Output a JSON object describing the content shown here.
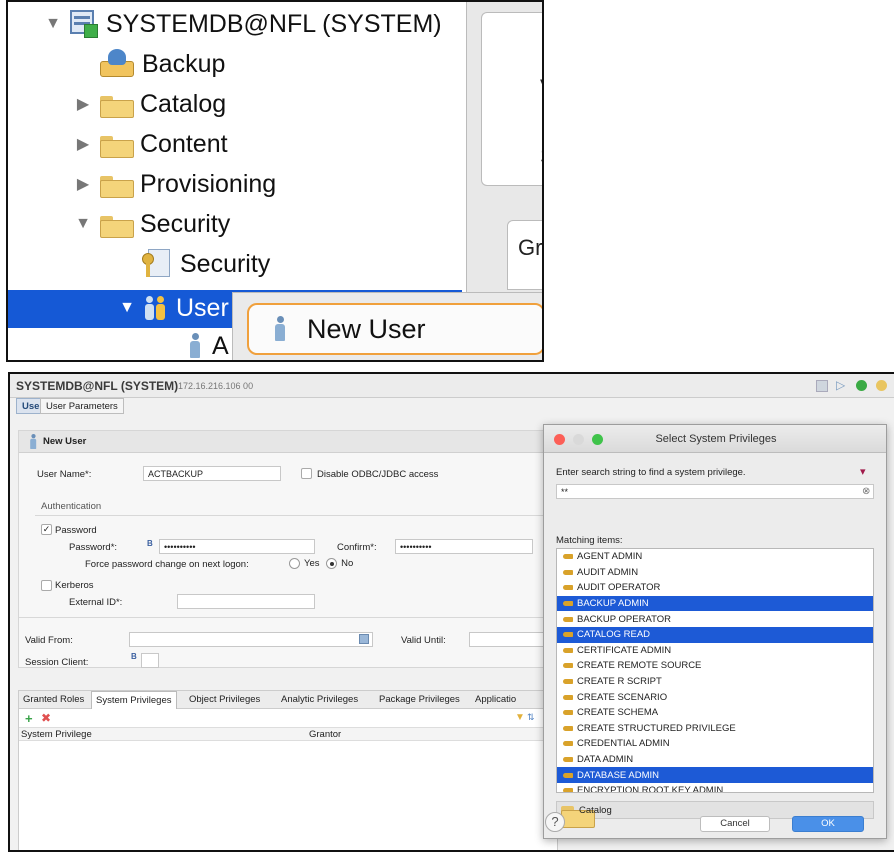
{
  "tree": {
    "root": "SYSTEMDB@NFL (SYSTEM)",
    "items": [
      {
        "label": "Backup"
      },
      {
        "label": "Catalog"
      },
      {
        "label": "Content"
      },
      {
        "label": "Provisioning"
      },
      {
        "label": "Security"
      },
      {
        "label": "Security"
      },
      {
        "label": "User"
      },
      {
        "label": "A"
      }
    ],
    "context_menu_item": "New User",
    "right_panel_fragments": [
      "V",
      "S",
      "Gr"
    ]
  },
  "window": {
    "title": "SYSTEMDB@NFL (SYSTEM)",
    "host": "172.16.216.106 00",
    "tabs": [
      "User",
      "User Parameters"
    ],
    "section_title": "New User",
    "user_name_label": "User Name*:",
    "user_name_value": "ACTBACKUP",
    "disable_odbc_label": "Disable ODBC/JDBC access",
    "authentication_label": "Authentication",
    "password_check_label": "Password",
    "password_label": "Password*:",
    "password_value": "••••••••••",
    "confirm_label": "Confirm*:",
    "confirm_value": "••••••••••",
    "force_label": "Force password change on next logon:",
    "yes_label": "Yes",
    "no_label": "No",
    "kerberos_label": "Kerberos",
    "external_id_label": "External ID*:",
    "valid_from_label": "Valid From:",
    "valid_until_label": "Valid Until:",
    "session_client_label": "Session Client:",
    "bottom_tabs": [
      "Granted Roles",
      "System Privileges",
      "Object Privileges",
      "Analytic Privileges",
      "Package Privileges",
      "Applicatio"
    ],
    "table_headers": [
      "System Privilege",
      "Grantor"
    ]
  },
  "dialog": {
    "title": "Select System Privileges",
    "prompt": "Enter search string to find a system privilege.",
    "search_value": "**",
    "matching_label": "Matching items:",
    "items": [
      {
        "label": "AGENT ADMIN",
        "selected": false
      },
      {
        "label": "AUDIT ADMIN",
        "selected": false
      },
      {
        "label": "AUDIT OPERATOR",
        "selected": false
      },
      {
        "label": "BACKUP ADMIN",
        "selected": true
      },
      {
        "label": "BACKUP OPERATOR",
        "selected": false
      },
      {
        "label": "CATALOG READ",
        "selected": true
      },
      {
        "label": "CERTIFICATE ADMIN",
        "selected": false
      },
      {
        "label": "CREATE REMOTE SOURCE",
        "selected": false
      },
      {
        "label": "CREATE R SCRIPT",
        "selected": false
      },
      {
        "label": "CREATE SCENARIO",
        "selected": false
      },
      {
        "label": "CREATE SCHEMA",
        "selected": false
      },
      {
        "label": "CREATE STRUCTURED PRIVILEGE",
        "selected": false
      },
      {
        "label": "CREDENTIAL ADMIN",
        "selected": false
      },
      {
        "label": "DATA ADMIN",
        "selected": false
      },
      {
        "label": "DATABASE ADMIN",
        "selected": true
      },
      {
        "label": "ENCRYPTION ROOT KEY ADMIN",
        "selected": false
      }
    ],
    "footer_item": "Catalog",
    "cancel_label": "Cancel",
    "ok_label": "OK",
    "colors": {
      "selection": "#1d5ad6",
      "ok_button": "#4a90e8",
      "accent_orange": "#f0a03c"
    }
  }
}
